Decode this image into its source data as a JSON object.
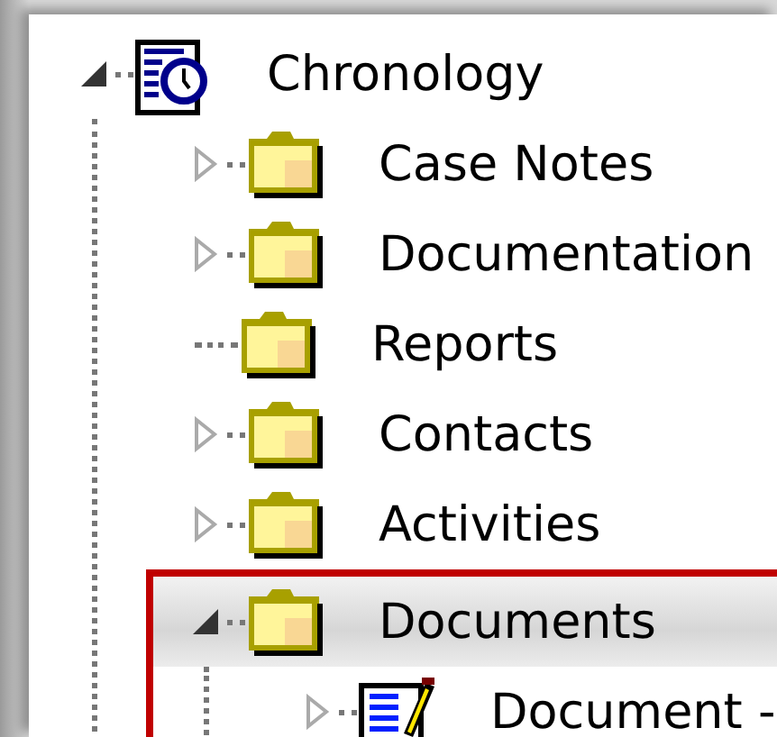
{
  "tree": [
    {
      "label": "Chronology",
      "kind": "chronology",
      "expandable": true,
      "expanded": true,
      "selected": false,
      "highlighted": false,
      "children": [
        {
          "label": "Case Notes",
          "kind": "folder",
          "expandable": true,
          "expanded": false,
          "selected": false,
          "highlighted": false
        },
        {
          "label": "Documentation",
          "kind": "folder",
          "expandable": true,
          "expanded": false,
          "selected": false,
          "highlighted": false
        },
        {
          "label": "Reports",
          "kind": "folder",
          "expandable": false,
          "selected": false,
          "highlighted": false
        },
        {
          "label": "Contacts",
          "kind": "folder",
          "expandable": true,
          "expanded": false,
          "selected": false,
          "highlighted": false
        },
        {
          "label": "Activities",
          "kind": "folder",
          "expandable": true,
          "expanded": false,
          "selected": false,
          "highlighted": false
        },
        {
          "label": "Documents",
          "kind": "folder",
          "expandable": true,
          "expanded": true,
          "selected": true,
          "highlighted": true,
          "children": [
            {
              "label": "Document -",
              "kind": "document",
              "expandable": true,
              "expanded": false,
              "selected": false,
              "highlighted": false
            }
          ]
        }
      ]
    }
  ]
}
